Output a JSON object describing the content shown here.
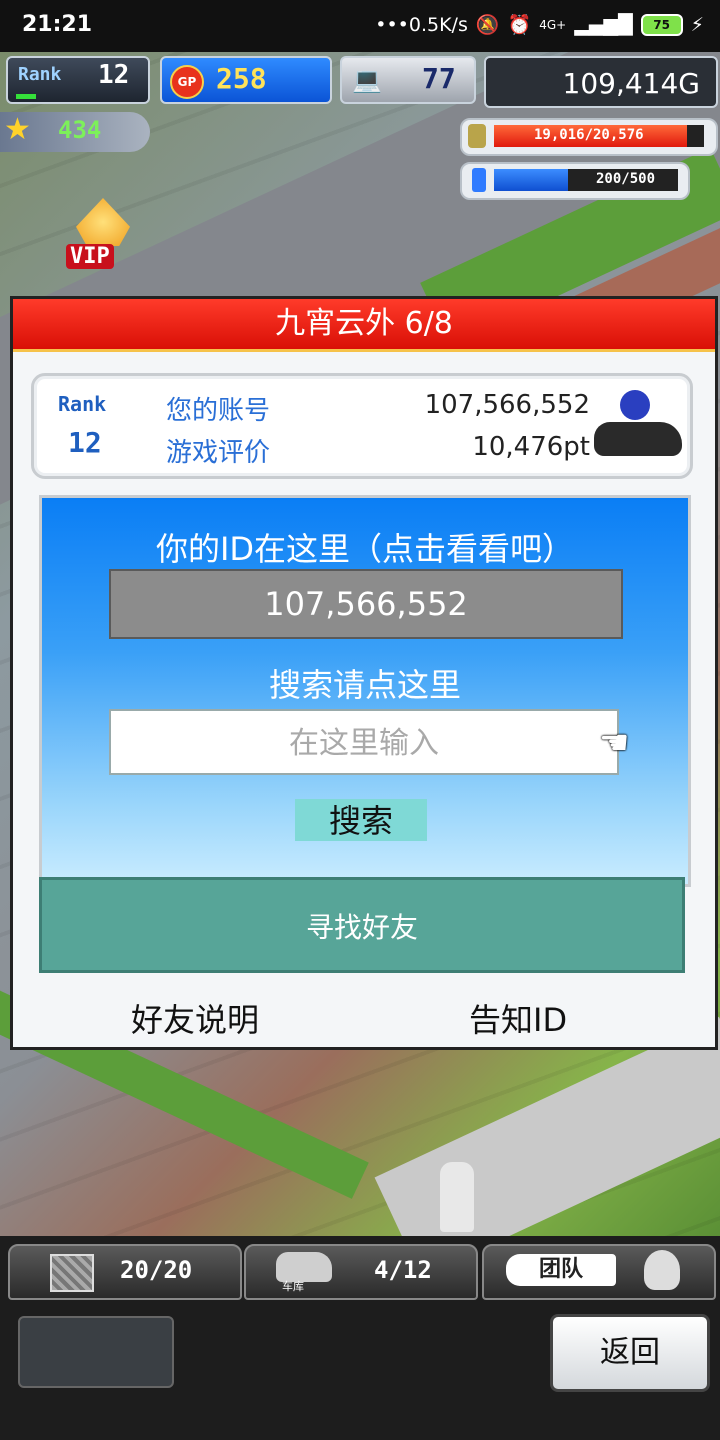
{
  "status": {
    "time": "21:21",
    "network": "•••0.5K/s",
    "signal": "4G+",
    "battery": "75"
  },
  "hud": {
    "rank_label": "Rank",
    "rank_value": "12",
    "gp_label": "GP",
    "gp_value": "258",
    "pc_value": "77",
    "money": "109,414G",
    "star_value": "434",
    "fuel_text": "19,016/20,576",
    "fuel_fraction": 0.92,
    "battery_text": "200/500",
    "battery_fraction": 0.4,
    "vip": "VIP"
  },
  "dialog": {
    "title": "九宵云外 6/8",
    "rank_label": "Rank",
    "rank_value": "12",
    "account_label": "您的账号",
    "account_value": "107,566,552",
    "rating_label": "游戏评价",
    "rating_value": "10,476pt",
    "id_heading": "你的ID在这里（点击看看吧）",
    "id_value": "107,566,552",
    "search_heading": "搜索请点这里",
    "search_placeholder": "在这里输入",
    "search_button": "搜索",
    "find_friends_button": "寻找好友",
    "friend_help_link": "好友说明",
    "announce_id_link": "告知ID"
  },
  "bottom": {
    "storage": "20/20",
    "garage_label": "车库",
    "garage_value": "4/12",
    "team_label": "团队",
    "back_button": "返回"
  }
}
